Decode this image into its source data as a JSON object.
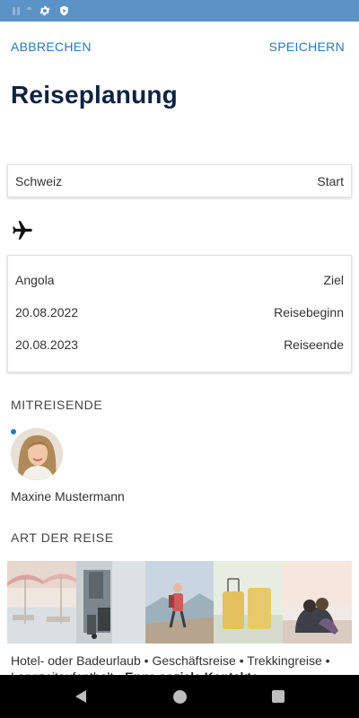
{
  "statusbar": {
    "icons": [
      "sim-icon",
      "settings-icon",
      "shield-icon"
    ]
  },
  "toolbar": {
    "cancel_label": "ABBRECHEN",
    "save_label": "SPEICHERN"
  },
  "page": {
    "title": "Reiseplanung"
  },
  "origin": {
    "value": "Schweiz",
    "label": "Start"
  },
  "destination": {
    "rows": [
      {
        "value": "Angola",
        "label": "Ziel"
      },
      {
        "value": "20.08.2022",
        "label": "Reisebeginn"
      },
      {
        "value": "20.08.2023",
        "label": "Reiseende"
      }
    ]
  },
  "travellers": {
    "heading": "MITREISENDE",
    "items": [
      {
        "name": "Maxine Mustermann"
      }
    ]
  },
  "trip_type": {
    "heading": "ART DER REISE",
    "images": [
      "beach-hotel",
      "business-traveller",
      "trekking-hiker",
      "luggage",
      "couple-at-beach"
    ],
    "options_text": "Hotel- oder Badeurlaub • Geschäftsreise • Trekkingreise • Langzeitaufenthalt • ",
    "highlighted": "Enge soziale Kontakte"
  },
  "colors": {
    "accent": "#2b78b3",
    "title": "#0f2340",
    "statusbar": "#5b93c6"
  }
}
